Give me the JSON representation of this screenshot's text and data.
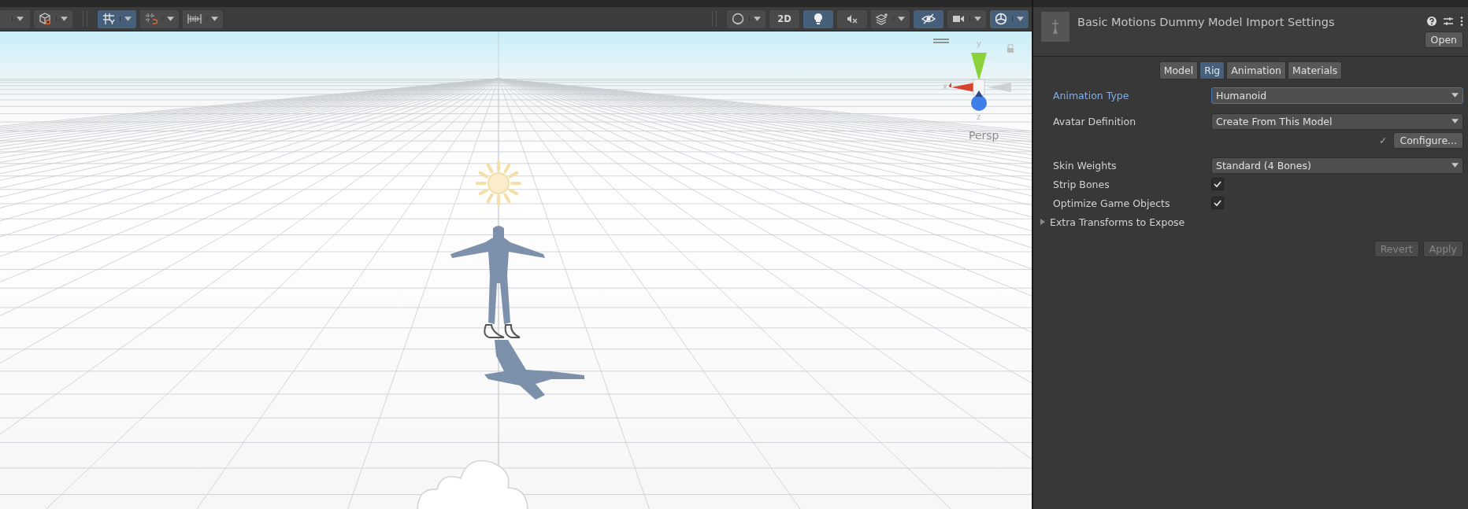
{
  "scene_toolbar": {
    "left": [
      {
        "kind": "partial",
        "on": false,
        "dropdown": true
      },
      {
        "kind": "draw-mode",
        "on": false,
        "dropdown": true
      },
      {
        "kind": "grid",
        "on": true,
        "dropdown": true
      },
      {
        "kind": "snap",
        "on": false,
        "dropdown": true
      },
      {
        "kind": "ruler",
        "on": false,
        "dropdown": true
      }
    ],
    "right": [
      {
        "kind": "shading",
        "on": false,
        "dropdown": true
      },
      {
        "kind": "text",
        "label": "2D",
        "on": false,
        "dropdown": false
      },
      {
        "kind": "light",
        "on": true,
        "dropdown": false
      },
      {
        "kind": "audio",
        "on": false,
        "dropdown": false
      },
      {
        "kind": "effects",
        "on": false,
        "dropdown": true
      },
      {
        "kind": "visibility",
        "on": true,
        "dropdown": false
      },
      {
        "kind": "camera",
        "on": false,
        "dropdown": true
      },
      {
        "kind": "gizmos",
        "on": true,
        "dropdown": true
      }
    ]
  },
  "scene": {
    "gizmo": {
      "axes": [
        "y",
        "x",
        "z"
      ],
      "projection": "Persp"
    }
  },
  "inspector": {
    "title": "Basic Motions Dummy Model Import Settings",
    "open_button": "Open",
    "tabs": [
      {
        "label": "Model",
        "selected": false
      },
      {
        "label": "Rig",
        "selected": true
      },
      {
        "label": "Animation",
        "selected": false
      },
      {
        "label": "Materials",
        "selected": false
      }
    ],
    "rows": [
      {
        "kind": "dropdown",
        "label": "Animation Type",
        "value": "Humanoid",
        "focused": true
      },
      {
        "kind": "dropdown",
        "label": "Avatar Definition",
        "value": "Create From This Model",
        "focused": false
      },
      {
        "kind": "configure",
        "check": "✓",
        "button": "Configure..."
      },
      {
        "kind": "dropdown",
        "label": "Skin Weights",
        "value": "Standard (4 Bones)",
        "focused": false
      },
      {
        "kind": "checkbox",
        "label": "Strip Bones",
        "checked": true
      },
      {
        "kind": "checkbox",
        "label": "Optimize Game Objects",
        "checked": true
      },
      {
        "kind": "foldout",
        "label": "Extra Transforms to Expose",
        "expanded": false
      }
    ],
    "buttons": [
      {
        "label": "Revert",
        "disabled": true
      },
      {
        "label": "Apply",
        "disabled": true
      }
    ]
  }
}
